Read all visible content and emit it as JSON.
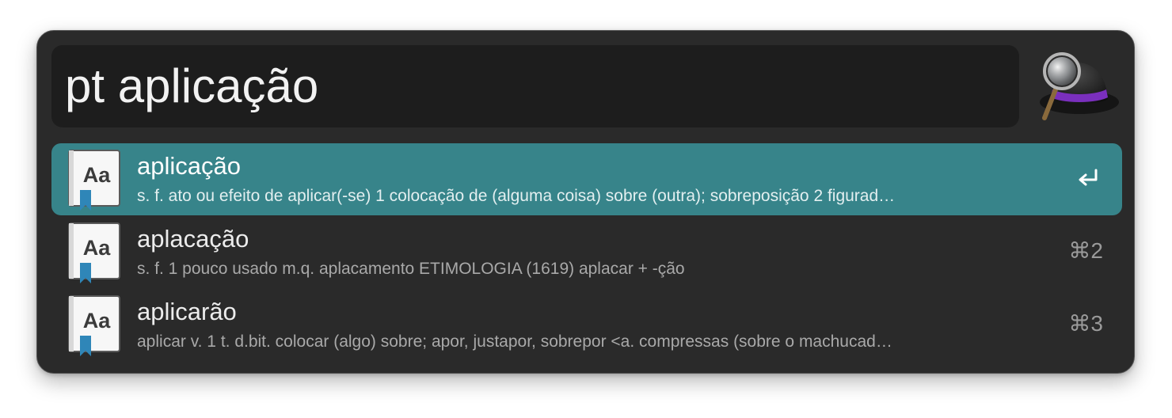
{
  "search": {
    "query": "pt aplicação"
  },
  "results": [
    {
      "title": "aplicação",
      "subtitle": "s. f. ato ou efeito de aplicar(-se) 1 colocação de (alguma coisa) sobre (outra); sobreposição 2 figurad…",
      "icon": "dictionary-icon",
      "shortcut_icon": "return-key-icon",
      "selected": true
    },
    {
      "title": "aplacação",
      "subtitle": "s. f. 1 pouco usado m.q. aplacamento ETIMOLOGIA (1619) aplacar + -ção",
      "icon": "dictionary-icon",
      "shortcut": "⌘2",
      "selected": false
    },
    {
      "title": "aplicarão",
      "subtitle": "aplicar v. 1 t. d.bit. colocar (algo) sobre; apor, justapor, sobrepor <a. compressas (sobre o machucad…",
      "icon": "dictionary-icon",
      "shortcut": "⌘3",
      "selected": false
    }
  ],
  "dictionary_icon_text": "Aa",
  "colors": {
    "selected_row": "#37848a",
    "window_bg": "#2a2a2a",
    "search_bg": "#1d1d1d",
    "bookmark": "#2f86b8",
    "hat_band": "#7a2fbd"
  }
}
